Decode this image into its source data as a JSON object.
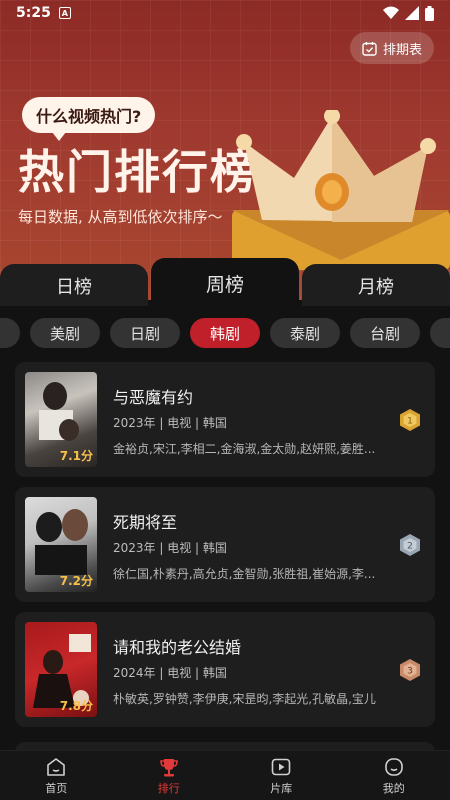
{
  "status_bar": {
    "time": "5:25",
    "notification_letter": "A"
  },
  "banner": {
    "schedule_label": "排期表",
    "bubble_text": "什么视频热门?",
    "title": "热门排行榜",
    "subtitle": "每日数据, 从高到低依次排序～"
  },
  "tabs": [
    {
      "label": "日榜",
      "active": false
    },
    {
      "label": "周榜",
      "active": true
    },
    {
      "label": "月榜",
      "active": false
    }
  ],
  "categories": [
    "美剧",
    "日剧",
    "韩剧",
    "泰剧",
    "台剧"
  ],
  "active_category": "韩剧",
  "dramas": [
    {
      "title": "与恶魔有约",
      "meta": "2023年 | 电视 | 韩国",
      "cast": "金裕贞,宋江,李相二,金海淑,金太勋,赵妍熙,姜胜...",
      "score": "7.1分",
      "rank_color": "#d9a431"
    },
    {
      "title": "死期将至",
      "meta": "2023年 | 电视 | 韩国",
      "cast": "徐仁国,朴素丹,高允贞,金智勋,张胜祖,崔始源,李...",
      "score": "7.2分",
      "rank_color": "#9aa6b4"
    },
    {
      "title": "请和我的老公结婚",
      "meta": "2024年 | 电视 | 韩国",
      "cast": "朴敏英,罗钟赞,李伊庚,宋昰昀,李起光,孔敏晶,宝儿",
      "score": "7.8分",
      "rank_color": "#c98a6a"
    }
  ],
  "nav": [
    {
      "label": "首页",
      "icon": "home-icon",
      "active": false
    },
    {
      "label": "排行",
      "icon": "trophy-icon",
      "active": true
    },
    {
      "label": "片库",
      "icon": "play-icon",
      "active": false
    },
    {
      "label": "我的",
      "icon": "profile-icon",
      "active": false
    }
  ],
  "colors": {
    "accent": "#c0202a",
    "nav_active": "#e23a3a",
    "background": "#121212"
  }
}
